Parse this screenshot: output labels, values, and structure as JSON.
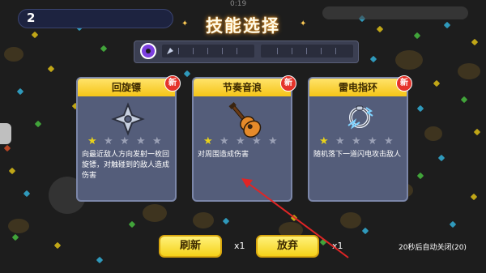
{
  "hud": {
    "level": "2",
    "timer": "0:19"
  },
  "title": "技能选择",
  "cards": [
    {
      "name": "回旋镖",
      "badge": "新",
      "icon": "shuriken-icon",
      "stars_filled": 1,
      "stars_total": 5,
      "desc": "向最近敌人方向发射一枚回旋镖，对触碰到的敌人造成伤害"
    },
    {
      "name": "节奏音浪",
      "badge": "新",
      "icon": "guitar-icon",
      "stars_filled": 1,
      "stars_total": 5,
      "desc": "对周围造成伤害"
    },
    {
      "name": "雷电指环",
      "badge": "新",
      "icon": "thunder-ring-icon",
      "stars_filled": 1,
      "stars_total": 5,
      "desc": "随机落下一道闪电攻击敌人"
    }
  ],
  "buttons": {
    "refresh": "刷新",
    "refresh_count": "x1",
    "abandon": "放弃",
    "abandon_count": "x1"
  },
  "auto_close": "20秒后自动关闭(20)",
  "colors": {
    "card_header": "#f5c517",
    "badge": "#e5332a",
    "star_filled": "#e8d21a",
    "star_empty": "#9aa0b5",
    "arrow": "#e02525"
  }
}
